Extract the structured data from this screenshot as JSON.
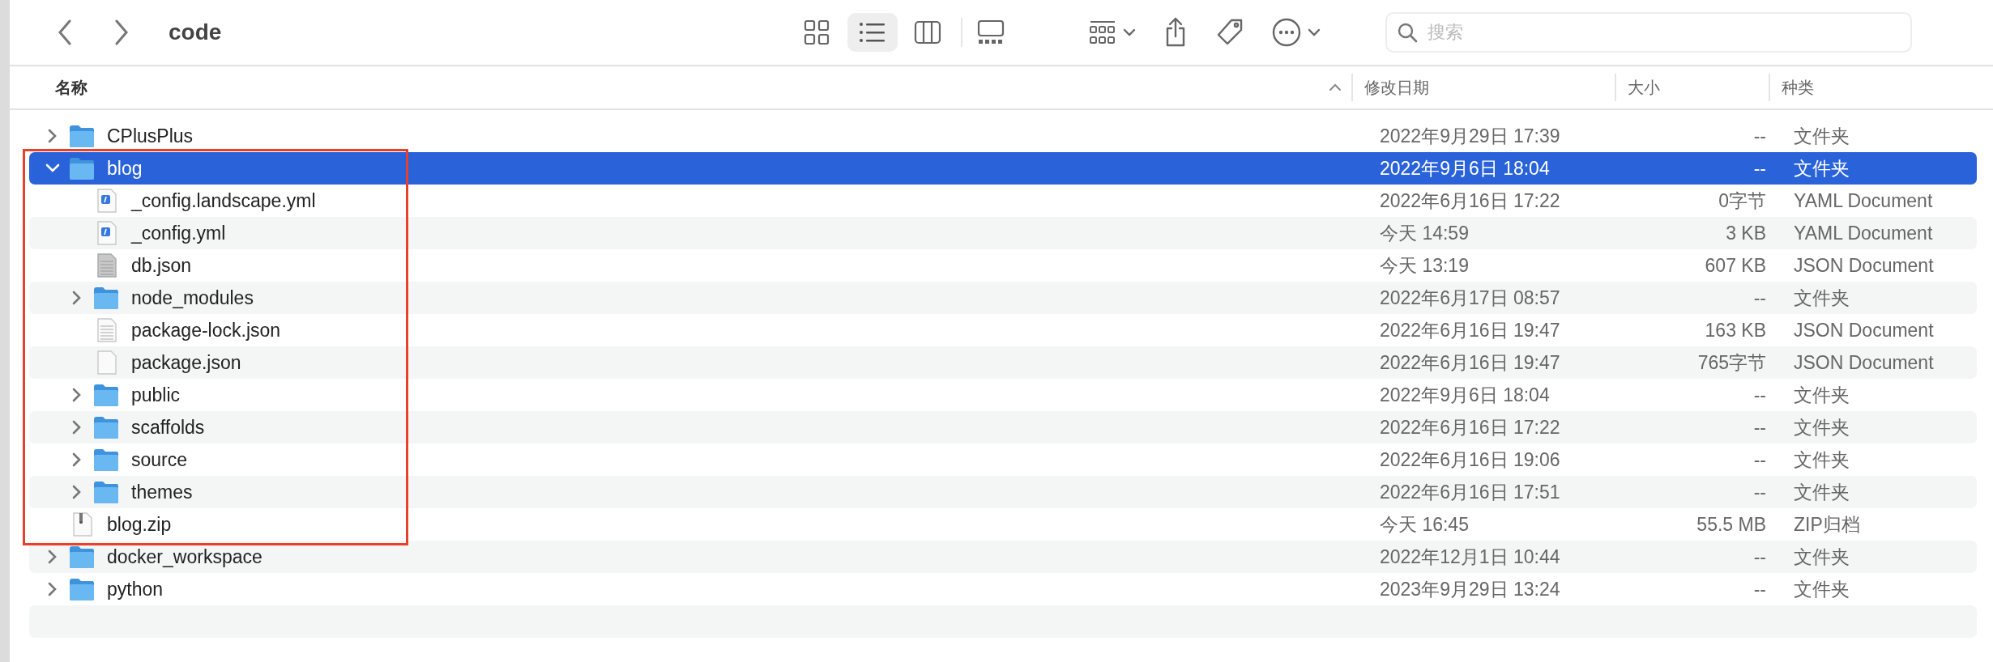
{
  "window": {
    "title": "code"
  },
  "toolbar": {
    "view_modes": [
      {
        "kind": "icons",
        "selected": false
      },
      {
        "kind": "list",
        "selected": true
      },
      {
        "kind": "columns",
        "selected": false
      },
      {
        "kind": "gallery",
        "selected": false
      }
    ],
    "search": {
      "placeholder": "搜索"
    }
  },
  "columns": [
    {
      "label": "名称",
      "sorted": true
    },
    {
      "label": "修改日期",
      "sorted": false
    },
    {
      "label": "大小",
      "sorted": false
    },
    {
      "label": "种类",
      "sorted": false
    }
  ],
  "files": [
    {
      "name": "CPlusPlus",
      "date": "2022年9月29日 17:39",
      "size": "--",
      "kind_label": "文件夹",
      "kind": "folder",
      "expanded": false,
      "selected": false
    },
    {
      "name": "blog",
      "date": "2022年9月6日 18:04",
      "size": "--",
      "kind_label": "文件夹",
      "kind": "folder",
      "expanded": true,
      "selected": true,
      "annotated": true,
      "children": [
        {
          "name": "_config.landscape.yml",
          "date": "2022年6月16日 17:22",
          "size": "0字节",
          "kind_label": "YAML Document",
          "kind": "yaml",
          "selected": false
        },
        {
          "name": "_config.yml",
          "date": "今天 14:59",
          "size": "3 KB",
          "kind_label": "YAML Document",
          "kind": "yaml",
          "selected": false
        },
        {
          "name": "db.json",
          "date": "今天 13:19",
          "size": "607 KB",
          "kind_label": "JSON Document",
          "kind": "dense",
          "selected": false
        },
        {
          "name": "node_modules",
          "date": "2022年6月17日 08:57",
          "size": "--",
          "kind_label": "文件夹",
          "kind": "folder",
          "expanded": false,
          "selected": false
        },
        {
          "name": "package-lock.json",
          "date": "2022年6月16日 19:47",
          "size": "163 KB",
          "kind_label": "JSON Document",
          "kind": "text",
          "selected": false
        },
        {
          "name": "package.json",
          "date": "2022年6月16日 19:47",
          "size": "765字节",
          "kind_label": "JSON Document",
          "kind": "blank",
          "selected": false
        },
        {
          "name": "public",
          "date": "2022年9月6日 18:04",
          "size": "--",
          "kind_label": "文件夹",
          "kind": "folder",
          "expanded": false,
          "selected": false
        },
        {
          "name": "scaffolds",
          "date": "2022年6月16日 17:22",
          "size": "--",
          "kind_label": "文件夹",
          "kind": "folder",
          "expanded": false,
          "selected": false
        },
        {
          "name": "source",
          "date": "2022年6月16日 19:06",
          "size": "--",
          "kind_label": "文件夹",
          "kind": "folder",
          "expanded": false,
          "selected": false
        },
        {
          "name": "themes",
          "date": "2022年6月16日 17:51",
          "size": "--",
          "kind_label": "文件夹",
          "kind": "folder",
          "expanded": false,
          "selected": false
        }
      ]
    },
    {
      "name": "blog.zip",
      "date": "今天 16:45",
      "size": "55.5 MB",
      "kind_label": "ZIP归档",
      "kind": "zip",
      "selected": false,
      "annotated": true
    },
    {
      "name": "docker_workspace",
      "date": "2022年12月1日 10:44",
      "size": "--",
      "kind_label": "文件夹",
      "kind": "folder",
      "expanded": false,
      "selected": false
    },
    {
      "name": "python",
      "date": "2023年9月29日 13:24",
      "size": "--",
      "kind_label": "文件夹",
      "kind": "folder",
      "expanded": false,
      "selected": false
    }
  ]
}
